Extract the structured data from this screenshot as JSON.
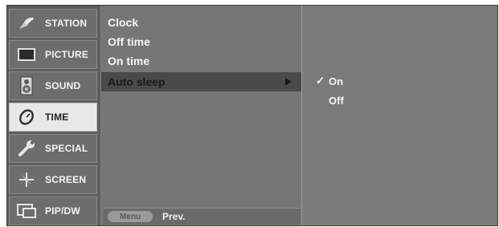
{
  "categories": [
    {
      "label": "STATION",
      "icon": "satellite-dish-icon",
      "active": false
    },
    {
      "label": "PICTURE",
      "icon": "tv-screen-icon",
      "active": false
    },
    {
      "label": "SOUND",
      "icon": "speaker-icon",
      "active": false
    },
    {
      "label": "TIME",
      "icon": "clock-dial-icon",
      "active": true
    },
    {
      "label": "SPECIAL",
      "icon": "wrench-icon",
      "active": false
    },
    {
      "label": "SCREEN",
      "icon": "crosshair-icon",
      "active": false
    },
    {
      "label": "PIP/DW",
      "icon": "pip-window-icon",
      "active": false
    }
  ],
  "submenu": {
    "items": [
      "Clock",
      "Off time",
      "On time",
      "Auto sleep"
    ],
    "selected_index": 3
  },
  "options": {
    "items": [
      "On",
      "Off"
    ],
    "checked_index": 0,
    "check_mark": "✓"
  },
  "footer": {
    "menu_key": "Menu",
    "prev_label": "Prev."
  },
  "colors": {
    "panel": "#7f7f7f",
    "active_category": "#e8e8e8",
    "selected_row": "#4a4a4a",
    "text": "#f6f6f6"
  }
}
